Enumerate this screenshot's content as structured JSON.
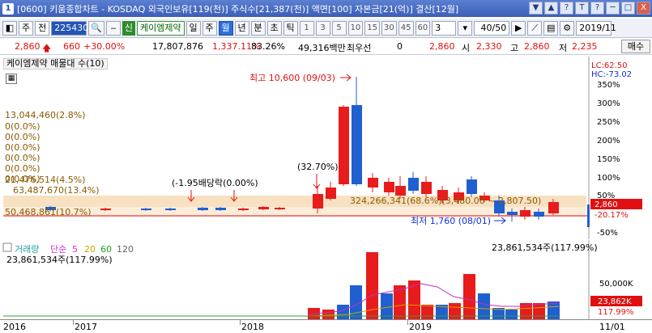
{
  "window": {
    "number": "1",
    "title": "[0600] 키움종합차트 - KOSDAQ 외국인보유[119(천)] 주식수[21,387(천)] 액면[100] 자본금[21(억)] 결산[12월]",
    "buttons": [
      "▼",
      "▲",
      "?",
      "T",
      "?",
      "─",
      "□",
      "X"
    ]
  },
  "toolbar": {
    "type_label": "주",
    "prev_label": "전",
    "code": "225430",
    "shin_label": "신",
    "stock_name": "케이엠제약",
    "periods": [
      "일",
      "주",
      "월",
      "년",
      "분",
      "초",
      "틱"
    ],
    "active_period": "월",
    "intervals": [
      "1",
      "3",
      "5",
      "10",
      "15",
      "30",
      "45",
      "60"
    ],
    "count_select": "3",
    "view_count": "40/50",
    "date": "2019/11"
  },
  "price": {
    "current": "2,860",
    "change": "660",
    "change_pct": "+30.00%",
    "volume": "17,807,876",
    "volume_pct": "1,337.11%",
    "turnover": "83.26%",
    "amount": "49,316백만",
    "preferred_label": "최우선",
    "preferred_value": "0",
    "close_label": "2,860",
    "open_label": "시",
    "open": "2,330",
    "high_label": "고",
    "high": "2,860",
    "low_label": "저",
    "low": "2,235",
    "buy_label": "매수"
  },
  "price_pane": {
    "title": "케이엠제약 매물대 수(10)",
    "lc_label": "LC:62.50",
    "hc_label": "HC:-73.02",
    "y_ticks": [
      "350%",
      "300%",
      "250%",
      "200%",
      "150%",
      "100%",
      "50%",
      "-50%"
    ],
    "current_tag": "2,860",
    "current_pct_tag": "-20.17%",
    "high_annotation": "최고 10,600 (09/03)",
    "low_annotation": "최저 1,760 (08/01)",
    "split_annotation": "(-1.95배당락(0.00%)",
    "rights_annotation": "(32.70%)",
    "band_labels": [
      "13,044,460(2.8%)",
      "0(0.0%)",
      "0(0.0%)",
      "0(0.0%)",
      "0(0.0%)",
      "0(0.0%)",
      "0(0.0%)",
      "21,476,514(4.5%)",
      "63,487,670(13.4%)",
      "50,468,861(10.7%)",
      "324,266,341(68.6%)(3,480.00 ~ 2,807.50)"
    ]
  },
  "volume_pane": {
    "title_label": "거래량",
    "legend": [
      "단순",
      "5",
      "20",
      "60",
      "120"
    ],
    "legend_colors": [
      "#d030d0",
      "#d030d0",
      "#d0a000",
      "#20a020",
      "#303030"
    ],
    "left_value": "23,861,534주(117.99%)",
    "right_value": "23,861,534주(117.99%)",
    "y_ticks": [
      "50,000K",
      "23,862K",
      "117.99%"
    ]
  },
  "x_axis": {
    "labels": [
      "2016",
      "2017",
      "2018",
      "2019",
      "11/01"
    ]
  },
  "colors": {
    "up": "#e81c1c",
    "down": "#1f5fd0",
    "band": "#f5d9b0",
    "accent": "#2455b6"
  }
}
